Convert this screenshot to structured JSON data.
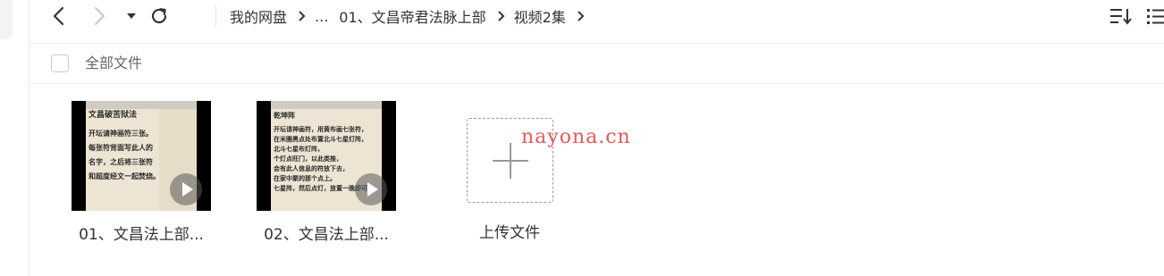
{
  "toolbar": {
    "back_icon": "chevron-left-icon",
    "forward_icon": "chevron-right-icon",
    "dropdown_icon": "caret-down-icon",
    "refresh_icon": "refresh-icon",
    "sort_icon": "sort-icon",
    "view_icon": "list-view-icon"
  },
  "breadcrumb": {
    "items": [
      "我的网盘",
      "...",
      "01、文昌帝君法脉上部",
      "视频2集"
    ]
  },
  "select_all": {
    "label": "全部文件",
    "checked": false
  },
  "files": [
    {
      "name": "01、文昌法上部...",
      "thumb_lines": [
        "文昌破苦狱法",
        "开坛请神画符三张。",
        "每张符背面写此人的",
        "名字，之后将三张符",
        "和超度经文一起焚烧。"
      ]
    },
    {
      "name": "02、文昌法上部...",
      "thumb_lines": [
        "乾坤阵",
        "开坛请神画符，用黄布画七张符，",
        "在米圈黑点处布置北斗七星灯阵，",
        "北斗七星布灯阵，",
        "个灯点旺门，以此类推，",
        "会有此人信息的符放下去，",
        "在家中聚的那个点上。",
        "七星阵，然后点灯，放置一晚即可。"
      ]
    }
  ],
  "upload": {
    "label": "上传文件",
    "icon": "plus-icon"
  },
  "watermark": "nayona.cn",
  "colors": {
    "text_primary": "#333333",
    "text_secondary": "#666666",
    "watermark": "#e05a5a",
    "border": "#ececec"
  }
}
